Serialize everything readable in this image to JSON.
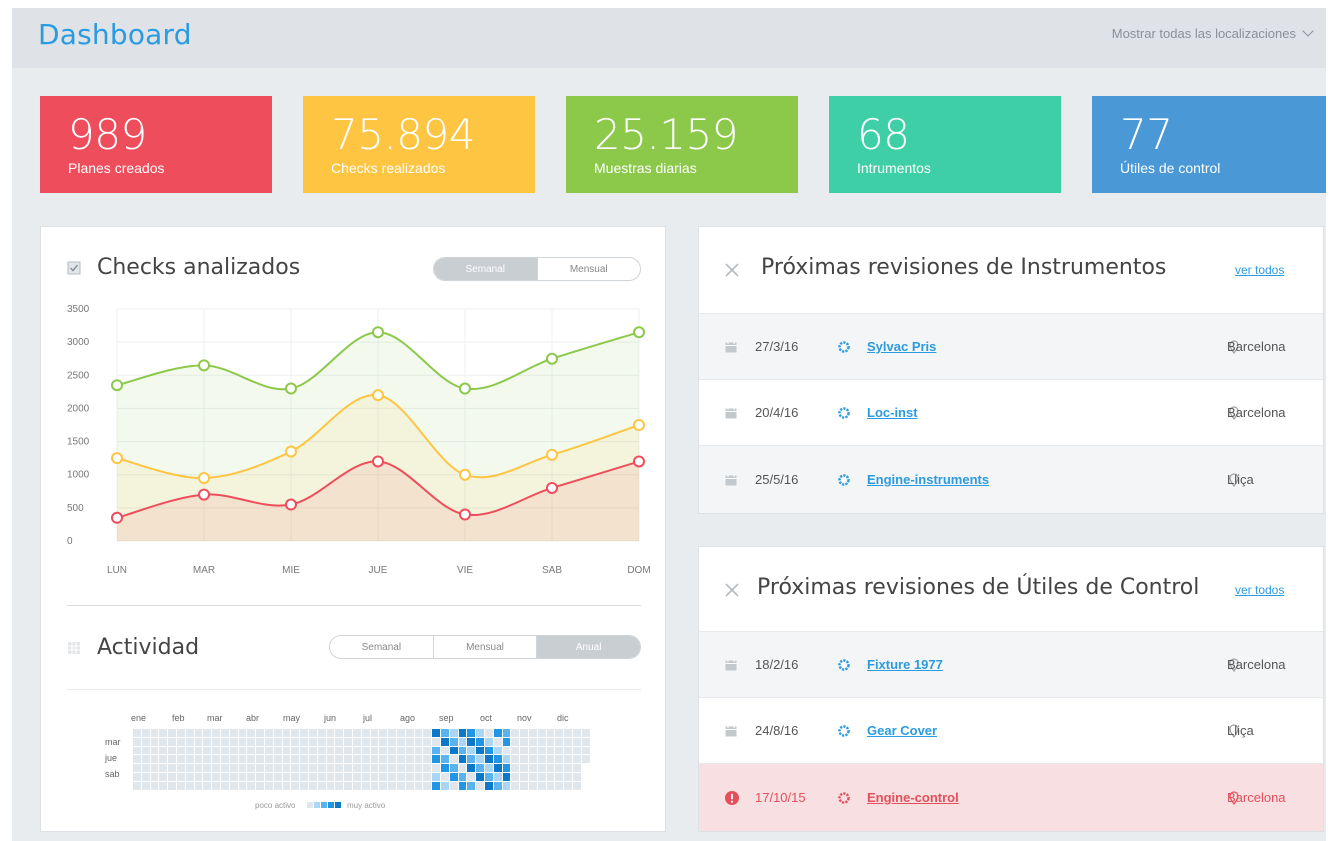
{
  "header": {
    "title": "Dashboard",
    "location_select": "Mostrar todas las localizaciones"
  },
  "cards": [
    {
      "value": "989",
      "label": "Planes creados",
      "color": "#ee4d5c"
    },
    {
      "value": "75.894",
      "label": "Checks realizados",
      "color": "#fdc542"
    },
    {
      "value": "25.159",
      "label": "Muestras diarias",
      "color": "#8cc94b"
    },
    {
      "value": "68",
      "label": "Intrumentos",
      "color": "#3fcfa6"
    },
    {
      "value": "77",
      "label": "Útiles de control",
      "color": "#4a98d6"
    }
  ],
  "checks_panel": {
    "title": "Checks analizados",
    "toggle": [
      "Semanal",
      "Mensual"
    ],
    "active_toggle": "Semanal"
  },
  "chart_data": {
    "type": "area",
    "title": "Checks analizados",
    "categories": [
      "LUN",
      "MAR",
      "MIE",
      "JUE",
      "VIE",
      "SAB",
      "DOM"
    ],
    "y_ticks": [
      "0",
      "500",
      "1000",
      "1500",
      "2000",
      "2500",
      "3000",
      "3500"
    ],
    "ylim": [
      0,
      3500
    ],
    "grid": true,
    "series": [
      {
        "values": [
          2350,
          2650,
          2300,
          3150,
          2300,
          2750,
          3150
        ],
        "color": "#8cc94b"
      },
      {
        "values": [
          1250,
          950,
          1350,
          2200,
          1000,
          1300,
          1750
        ],
        "color": "#fdc542"
      },
      {
        "values": [
          350,
          700,
          550,
          1200,
          400,
          800,
          1200
        ],
        "color": "#ee4d5c"
      }
    ]
  },
  "activity_panel": {
    "title": "Actividad",
    "toggle": [
      "Semanal",
      "Mensual",
      "Anual"
    ],
    "active_toggle": "Anual",
    "months": [
      "ene",
      "feb",
      "mar",
      "abr",
      "may",
      "jun",
      "jul",
      "ago",
      "sep",
      "oct",
      "nov",
      "dic"
    ],
    "days": [
      "mar",
      "jue",
      "sab"
    ],
    "legend_low": "poco activo",
    "legend_high": "muy activo",
    "colors": [
      "#dfe6ec",
      "#a9d6f5",
      "#5ab3ee",
      "#2196e5",
      "#0b78c9"
    ]
  },
  "instruments_panel": {
    "title": "Próximas revisiones de Instrumentos",
    "link": "ver todos",
    "rows": [
      {
        "date": "27/3/16",
        "name": "Sylvac Pris",
        "city": "Barcelona"
      },
      {
        "date": "20/4/16",
        "name": "Loc-inst",
        "city": "Barcelona"
      },
      {
        "date": "25/5/16",
        "name": "Engine-instruments",
        "city": "Lliça"
      }
    ]
  },
  "tools_panel": {
    "title": "Próximas revisiones de Útiles de Control",
    "link": "ver todos",
    "rows": [
      {
        "date": "18/2/16",
        "name": "Fixture 1977",
        "city": "Barcelona",
        "alert": false
      },
      {
        "date": "24/8/16",
        "name": "Gear Cover",
        "city": "Lliça",
        "alert": false
      },
      {
        "date": "17/10/15",
        "name": "Engine-control",
        "city": "Barcelona",
        "alert": true
      }
    ]
  }
}
